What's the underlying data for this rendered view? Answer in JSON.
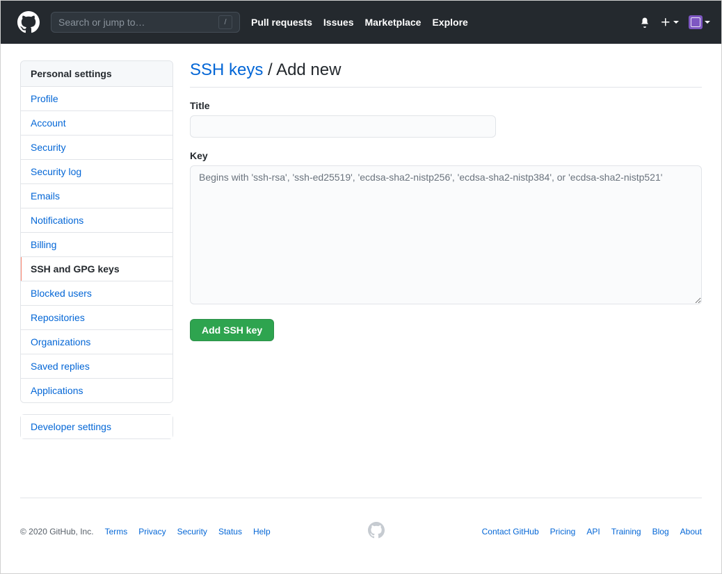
{
  "header": {
    "search_placeholder": "Search or jump to…",
    "slash_hint": "/",
    "nav": [
      "Pull requests",
      "Issues",
      "Marketplace",
      "Explore"
    ]
  },
  "sidebar": {
    "title": "Personal settings",
    "items": [
      {
        "label": "Profile",
        "active": false
      },
      {
        "label": "Account",
        "active": false
      },
      {
        "label": "Security",
        "active": false
      },
      {
        "label": "Security log",
        "active": false
      },
      {
        "label": "Emails",
        "active": false
      },
      {
        "label": "Notifications",
        "active": false
      },
      {
        "label": "Billing",
        "active": false
      },
      {
        "label": "SSH and GPG keys",
        "active": true
      },
      {
        "label": "Blocked users",
        "active": false
      },
      {
        "label": "Repositories",
        "active": false
      },
      {
        "label": "Organizations",
        "active": false
      },
      {
        "label": "Saved replies",
        "active": false
      },
      {
        "label": "Applications",
        "active": false
      }
    ],
    "secondary": {
      "label": "Developer settings"
    }
  },
  "main": {
    "crumb_link": "SSH keys",
    "crumb_sep": " / ",
    "crumb_current": "Add new",
    "title_label": "Title",
    "key_label": "Key",
    "key_placeholder": "Begins with 'ssh-rsa', 'ssh-ed25519', 'ecdsa-sha2-nistp256', 'ecdsa-sha2-nistp384', or 'ecdsa-sha2-nistp521'",
    "submit_label": "Add SSH key"
  },
  "footer": {
    "copyright": "© 2020 GitHub, Inc.",
    "left_links": [
      "Terms",
      "Privacy",
      "Security",
      "Status",
      "Help"
    ],
    "right_links": [
      "Contact GitHub",
      "Pricing",
      "API",
      "Training",
      "Blog",
      "About"
    ]
  }
}
